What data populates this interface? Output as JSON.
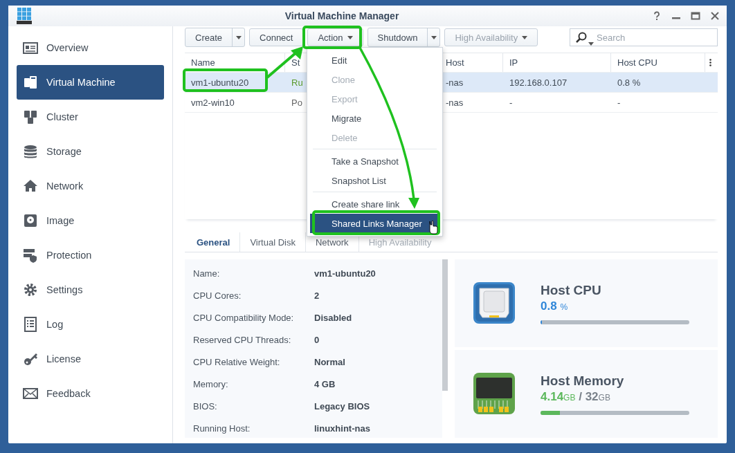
{
  "window": {
    "title": "Virtual Machine Manager"
  },
  "sidebar": {
    "items": [
      {
        "label": "Overview",
        "selected": false
      },
      {
        "label": "Virtual Machine",
        "selected": true
      },
      {
        "label": "Cluster",
        "selected": false
      },
      {
        "label": "Storage",
        "selected": false
      },
      {
        "label": "Network",
        "selected": false
      },
      {
        "label": "Image",
        "selected": false
      },
      {
        "label": "Protection",
        "selected": false
      },
      {
        "label": "Settings",
        "selected": false
      },
      {
        "label": "Log",
        "selected": false
      },
      {
        "label": "License",
        "selected": false
      },
      {
        "label": "Feedback",
        "selected": false
      }
    ]
  },
  "toolbar": {
    "buttons": [
      {
        "label": "Create",
        "kind": "split",
        "disabled": false
      },
      {
        "label": "Connect",
        "kind": "plain",
        "disabled": false
      },
      {
        "label": "Action",
        "kind": "dropdown",
        "disabled": false
      },
      {
        "label": "Shutdown",
        "kind": "split",
        "disabled": false
      },
      {
        "label": "High Availability",
        "kind": "dropdown",
        "disabled": true
      }
    ]
  },
  "search": {
    "placeholder": "Search"
  },
  "table": {
    "columns": [
      "Name",
      "St",
      "Host",
      "IP",
      "Host CPU"
    ],
    "rows": [
      {
        "selected": true,
        "color": "#5a9a2a",
        "cells": [
          "vm1-ubuntu20",
          "Ru",
          "-nas",
          "192.168.0.107",
          "0.8 %"
        ]
      },
      {
        "selected": false,
        "color": "#666666",
        "cells": [
          "vm2-win10",
          "Po",
          "-nas",
          "-",
          "-"
        ]
      }
    ]
  },
  "action_menu": {
    "items": [
      {
        "label": "Edit",
        "disabled": false,
        "selected": false,
        "divider_before": false
      },
      {
        "label": "Clone",
        "disabled": true,
        "selected": false,
        "divider_before": false
      },
      {
        "label": "Export",
        "disabled": true,
        "selected": false,
        "divider_before": false
      },
      {
        "label": "Migrate",
        "disabled": false,
        "selected": false,
        "divider_before": false
      },
      {
        "label": "Delete",
        "disabled": true,
        "selected": false,
        "divider_before": false
      },
      {
        "label": "Take a Snapshot",
        "disabled": false,
        "selected": false,
        "divider_before": true
      },
      {
        "label": "Snapshot List",
        "disabled": false,
        "selected": false,
        "divider_before": false
      },
      {
        "label": "Create share link",
        "disabled": false,
        "selected": false,
        "divider_before": true
      },
      {
        "label": "Shared Links Manager",
        "disabled": false,
        "selected": true,
        "divider_before": false
      }
    ]
  },
  "detail_tabs": [
    {
      "label": "General",
      "selected": true,
      "disabled": false
    },
    {
      "label": "Virtual Disk",
      "selected": false,
      "disabled": false
    },
    {
      "label": "Network",
      "selected": false,
      "disabled": false
    },
    {
      "label": "High Availability",
      "selected": false,
      "disabled": true
    }
  ],
  "details": [
    {
      "label": "Name:",
      "value": "vm1-ubuntu20"
    },
    {
      "label": "CPU Cores:",
      "value": "2"
    },
    {
      "label": "CPU Compatibility Mode:",
      "value": "Disabled"
    },
    {
      "label": "Reserved CPU Threads:",
      "value": "0"
    },
    {
      "label": "CPU Relative Weight:",
      "value": "Normal"
    },
    {
      "label": "Memory:",
      "value": "4 GB"
    },
    {
      "label": "BIOS:",
      "value": "Legacy BIOS"
    },
    {
      "label": "Running Host:",
      "value": "linuxhint-nas"
    }
  ],
  "host_cpu": {
    "title": "Host CPU",
    "value": "0.8",
    "unit": "%",
    "level": 0.008
  },
  "host_memory": {
    "title": "Host Memory",
    "used": "4.14",
    "used_unit": "GB",
    "separator": "/",
    "total": "32",
    "total_unit": "GB",
    "level": 0.13
  }
}
